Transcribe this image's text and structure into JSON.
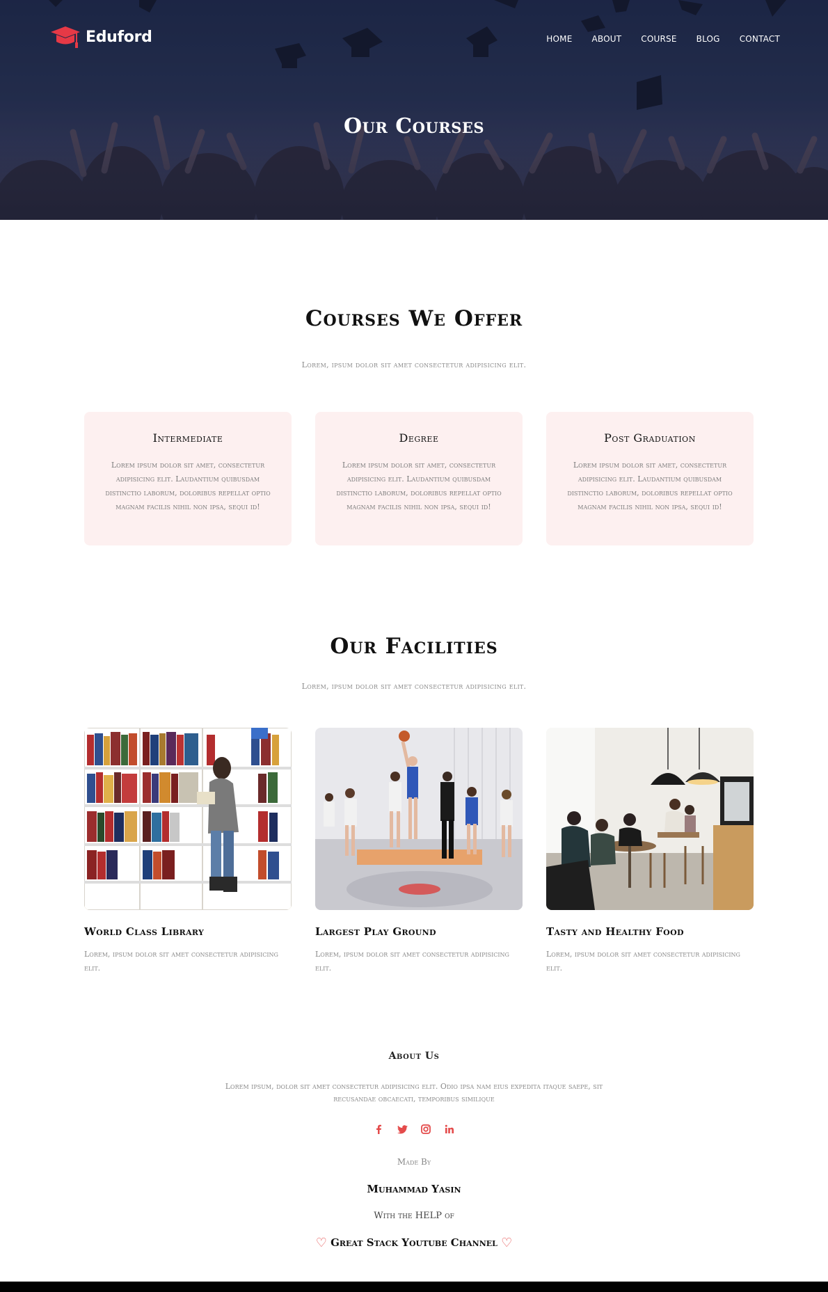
{
  "brand": {
    "name": "Eduford",
    "logo_icon": "graduation-cap-icon",
    "accent": "#e63946"
  },
  "nav": {
    "items": [
      "HOME",
      "ABOUT",
      "COURSE",
      "BLOG",
      "CONTACT"
    ]
  },
  "hero": {
    "title": "Our Courses"
  },
  "courses": {
    "title": "Courses We Offer",
    "subtitle": "Lorem, ipsum dolor sit amet consectetur adipisicing elit.",
    "cards": [
      {
        "title": "Intermediate",
        "text": "Lorem ipsum dolor sit amet, consectetur adipisicing elit. Laudantium quibusdam distinctio laborum, doloribus repellat optio magnam facilis nihil non ipsa, sequi id!"
      },
      {
        "title": "Degree",
        "text": "Lorem ipsum dolor sit amet, consectetur adipisicing elit. Laudantium quibusdam distinctio laborum, doloribus repellat optio magnam facilis nihil non ipsa, sequi id!"
      },
      {
        "title": "Post Graduation",
        "text": "Lorem ipsum dolor sit amet, consectetur adipisicing elit. Laudantium quibusdam distinctio laborum, doloribus repellat optio magnam facilis nihil non ipsa, sequi id!"
      }
    ]
  },
  "facilities": {
    "title": "Our Facilities",
    "subtitle": "Lorem, ipsum dolor sit amet consectetur adipisicing elit.",
    "items": [
      {
        "title": "World Class Library",
        "text": "Lorem, ipsum dolor sit amet consectetur adipisicing elit."
      },
      {
        "title": "Largest Play Ground",
        "text": "Lorem, ipsum dolor sit amet consectetur adipisicing elit."
      },
      {
        "title": "Tasty and Healthy Food",
        "text": "Lorem, ipsum dolor sit amet consectetur adipisicing elit."
      }
    ]
  },
  "footer": {
    "about_title": "About Us",
    "about_text": "Lorem ipsum, dolor sit amet consectetur adipisicing elit. Odio ipsa nam eius expedita itaque saepe, sit recusandae obcaecati, temporibus similique",
    "socials": [
      "facebook-icon",
      "twitter-icon",
      "instagram-icon",
      "linkedin-icon"
    ],
    "made_by": "Made By",
    "author": "Muhammad Yasin",
    "with_help": "With the HELP of",
    "channel": "Great Stack Youtube Channel",
    "social_color": "#e44b4b"
  }
}
